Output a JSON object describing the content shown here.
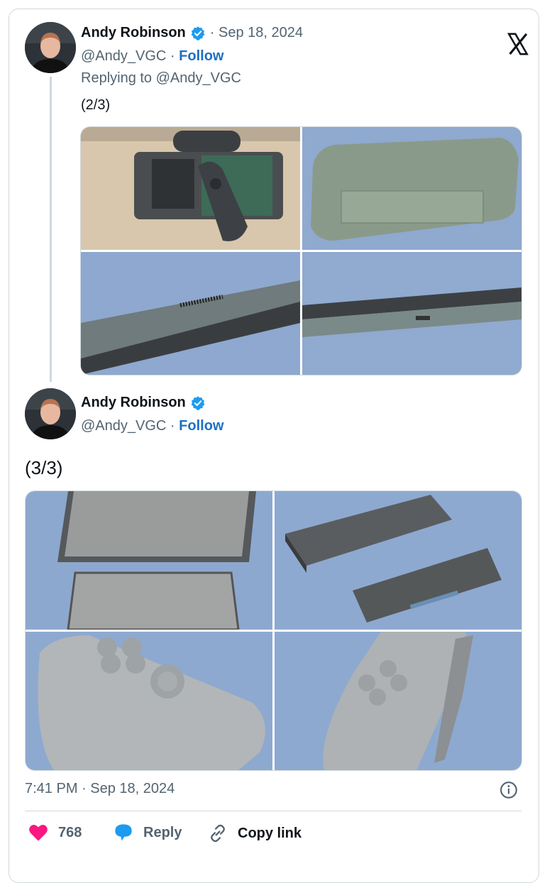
{
  "tweet1": {
    "author_name": "Andy Robinson",
    "date": "· Sep 18, 2024",
    "handle": "@Andy_VGC",
    "sep": " · ",
    "follow": "Follow",
    "replying_to": "Replying to @Andy_VGC",
    "text": "(2/3)"
  },
  "tweet2": {
    "author_name": "Andy Robinson",
    "handle": "@Andy_VGC",
    "sep": " · ",
    "follow": "Follow",
    "text": "(3/3)",
    "timestamp": "7:41 PM · Sep 18, 2024"
  },
  "actions": {
    "like_count": "768",
    "reply_label": "Reply",
    "copy_label": "Copy link"
  },
  "icons": {
    "logo": "x-logo-icon",
    "verified": "verified-badge-icon",
    "info": "info-icon",
    "like": "heart-icon",
    "reply": "reply-bubble-icon",
    "copy": "link-icon"
  },
  "colors": {
    "verified": "#1d9bf0",
    "follow": "#1d70c2",
    "like": "#f91880",
    "reply_icon": "#1d9bf0",
    "muted": "#536471"
  }
}
